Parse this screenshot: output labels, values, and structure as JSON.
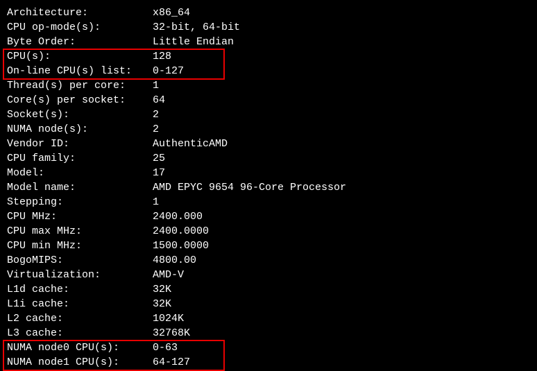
{
  "rows": [
    {
      "label": "Architecture:",
      "value": "x86_64"
    },
    {
      "label": "CPU op-mode(s):",
      "value": "32-bit, 64-bit"
    },
    {
      "label": "Byte Order:",
      "value": "Little Endian"
    },
    {
      "label": "CPU(s):",
      "value": "128"
    },
    {
      "label": "On-line CPU(s) list:",
      "value": "0-127"
    },
    {
      "label": "Thread(s) per core:",
      "value": "1"
    },
    {
      "label": "Core(s) per socket:",
      "value": "64"
    },
    {
      "label": "Socket(s):",
      "value": "2"
    },
    {
      "label": "NUMA node(s):",
      "value": "2"
    },
    {
      "label": "Vendor ID:",
      "value": "AuthenticAMD"
    },
    {
      "label": "CPU family:",
      "value": "25"
    },
    {
      "label": "Model:",
      "value": "17"
    },
    {
      "label": "Model name:",
      "value": "AMD EPYC 9654 96-Core Processor"
    },
    {
      "label": "Stepping:",
      "value": "1"
    },
    {
      "label": "CPU MHz:",
      "value": "2400.000"
    },
    {
      "label": "CPU max MHz:",
      "value": "2400.0000"
    },
    {
      "label": "CPU min MHz:",
      "value": "1500.0000"
    },
    {
      "label": "BogoMIPS:",
      "value": "4800.00"
    },
    {
      "label": "Virtualization:",
      "value": "AMD-V"
    },
    {
      "label": "L1d cache:",
      "value": "32K"
    },
    {
      "label": "L1i cache:",
      "value": "32K"
    },
    {
      "label": "L2 cache:",
      "value": "1024K"
    },
    {
      "label": "L3 cache:",
      "value": "32768K"
    },
    {
      "label": "NUMA node0 CPU(s):",
      "value": "0-63"
    },
    {
      "label": "NUMA node1 CPU(s):",
      "value": "64-127"
    }
  ]
}
